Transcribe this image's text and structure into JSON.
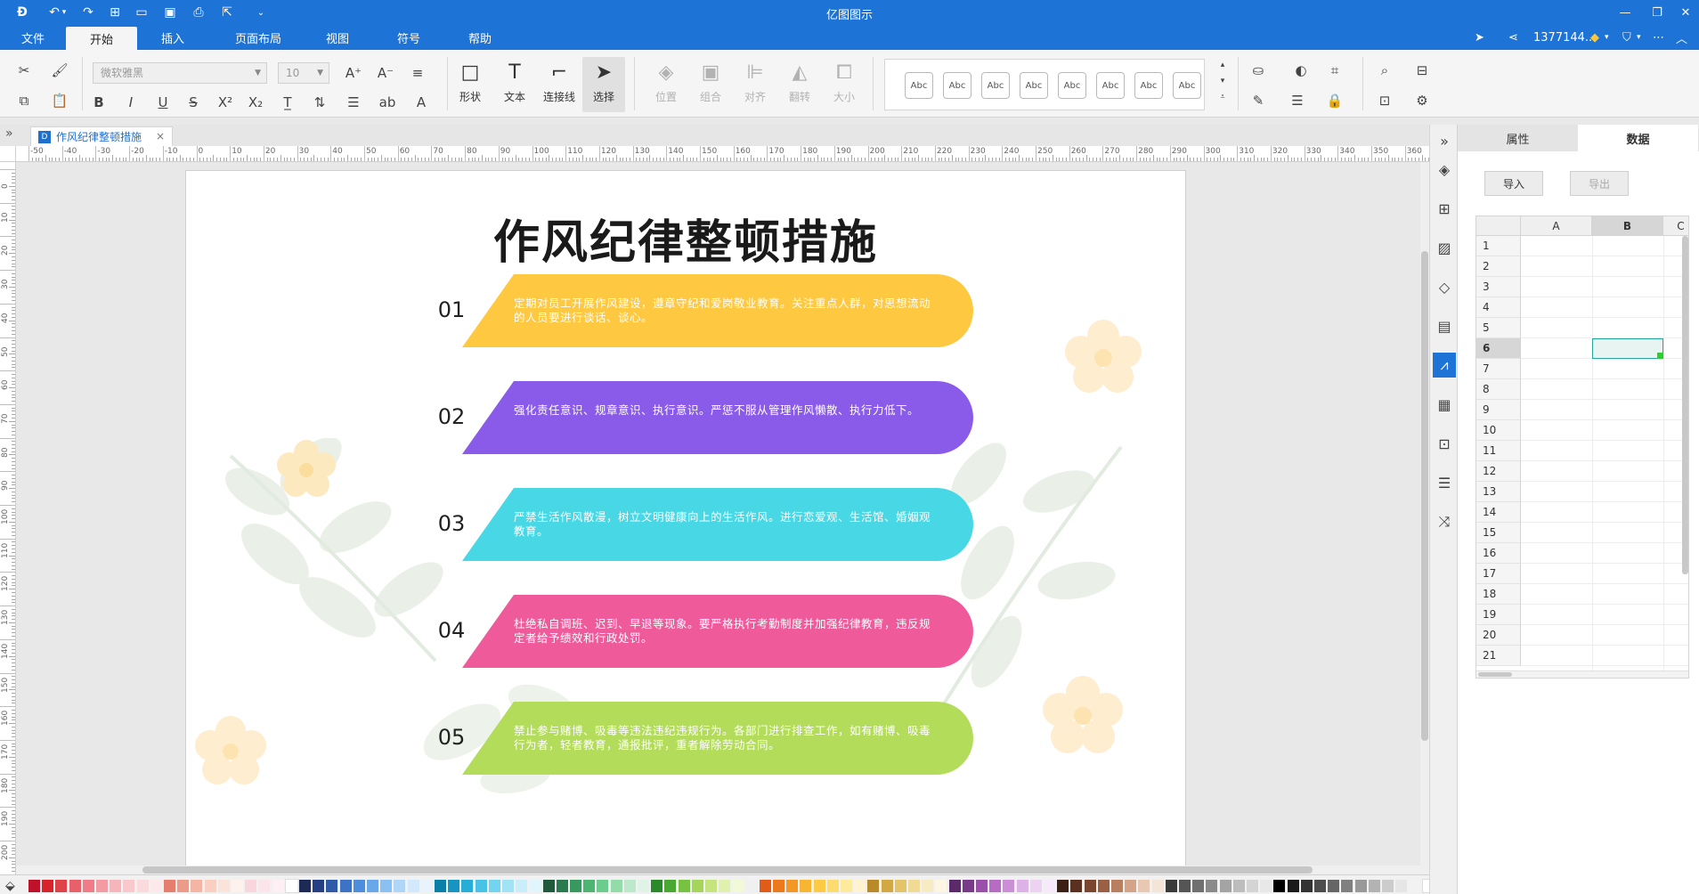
{
  "titlebar": {
    "title": "亿图图示",
    "quick_access": [
      "logo-icon",
      "undo-icon",
      "undo-dropdown-icon",
      "redo-icon",
      "new-icon",
      "open-icon",
      "save-icon",
      "print-icon",
      "export-icon",
      "customize-icon"
    ]
  },
  "menu": {
    "file": "文件",
    "tabs": [
      "开始",
      "插入",
      "页面布局",
      "视图",
      "符号",
      "帮助"
    ],
    "active_tab": "开始",
    "user": "1377144...",
    "accent": "#1d73d6"
  },
  "ribbon": {
    "font_name": "微软雅黑",
    "font_size": "10",
    "big_buttons": {
      "shape": "形状",
      "text": "文本",
      "connector": "连接线",
      "select": "选择",
      "position": "位置",
      "group": "组合",
      "align": "对齐",
      "flip": "翻转",
      "size": "大小"
    },
    "style_samples": [
      "Abc",
      "Abc",
      "Abc",
      "Abc",
      "Abc",
      "Abc",
      "Abc",
      "Abc"
    ]
  },
  "document": {
    "tab_name": "作风纪律整顿措施",
    "close": "×"
  },
  "ruler": {
    "h_labels": [
      "-50",
      "-40",
      "-30",
      "-20",
      "-10",
      "0",
      "10",
      "20",
      "30",
      "40",
      "50",
      "60",
      "70",
      "80",
      "90",
      "100",
      "110",
      "120",
      "130",
      "140",
      "150",
      "160",
      "170",
      "180",
      "190",
      "200",
      "210",
      "220",
      "230",
      "240",
      "250",
      "260",
      "270",
      "280",
      "290",
      "300",
      "310",
      "320",
      "330",
      "340",
      "350",
      "360"
    ],
    "v_labels": [
      "0",
      "10",
      "20",
      "30",
      "40",
      "50",
      "60",
      "70",
      "80",
      "90",
      "100",
      "110",
      "120",
      "130",
      "140",
      "150",
      "160",
      "170",
      "180",
      "190",
      "200"
    ]
  },
  "slide": {
    "title": "作风纪律整顿措施",
    "items": [
      {
        "num": "01",
        "text": "定期对员工开展作风建设，遵章守纪和爱岗敬业教育。关注重点人群，对思想流动的人员要进行谈话、谈心。",
        "color": "#fec840"
      },
      {
        "num": "02",
        "text": "强化责任意识、规章意识、执行意识。严惩不服从管理作风懒散、执行力低下。",
        "color": "#8a5ae8"
      },
      {
        "num": "03",
        "text": "严禁生活作风散漫，树立文明健康向上的生活作风。进行恋爱观、生活馆、婚姻观教育。",
        "color": "#48d7e4"
      },
      {
        "num": "04",
        "text": "杜绝私自调班、迟到、早退等现象。要严格执行考勤制度并加强纪律教育，违反规定者给予绩效和行政处罚。",
        "color": "#ef5a9a"
      },
      {
        "num": "05",
        "text": "禁止参与赌博、吸毒等违法违纪违规行为。各部门进行排查工作，如有赌博、吸毒行为者，轻者教育，通报批评，重者解除劳动合同。",
        "color": "#b3dc5a"
      }
    ]
  },
  "palette": {
    "colors": [
      "#c0112b",
      "#d9222a",
      "#e0424a",
      "#e8606a",
      "#ef7c86",
      "#f39aa2",
      "#f6b4bb",
      "#f8c8cc",
      "#fadadd",
      "#fde8ea",
      "#e67e6e",
      "#ee9a88",
      "#f4b5a4",
      "#f8cfc1",
      "#fbe3da",
      "#fff1ec",
      "#f9d5de",
      "#fbe4ea",
      "#fdeff3",
      "#ffffff",
      "#1c2a55",
      "#253f85",
      "#2e5aa8",
      "#3c73c4",
      "#4c8edc",
      "#67a7ea",
      "#8bc0f2",
      "#b0d6f7",
      "#d2e8fb",
      "#e8f3fd",
      "#0c7fa8",
      "#1596c2",
      "#27add6",
      "#48c3e6",
      "#73d4ef",
      "#9fe3f5",
      "#c8eefa",
      "#e1f6fc",
      "#1f5a3c",
      "#2a7a4f",
      "#38985f",
      "#4cb572",
      "#6ccc8b",
      "#93dcaa",
      "#bce9ca",
      "#dff4e6",
      "#2a8a2a",
      "#4aa832",
      "#78c242",
      "#a5d65a",
      "#c6e47e",
      "#e0f0ad",
      "#f2f9d8",
      "#f0f0f0",
      "#e05c18",
      "#ec7a1c",
      "#f39825",
      "#f8b531",
      "#fcca44",
      "#fddb6c",
      "#feea9c",
      "#fff4cf",
      "#b98a2a",
      "#d1a844",
      "#e3c468",
      "#f0db95",
      "#f8ebc2",
      "#fdf6e3",
      "#5a2a6a",
      "#7a3a8a",
      "#9a4fa8",
      "#b56cc2",
      "#cb8fd6",
      "#ddb2e6",
      "#ecd3f2",
      "#f6e9f9",
      "#3a1f14",
      "#5a3020",
      "#7a4630",
      "#9a6044",
      "#b88060",
      "#d4a488",
      "#e8c8b2",
      "#f5e4d8",
      "#3a3a3a",
      "#555555",
      "#707070",
      "#8a8a8a",
      "#a4a4a4",
      "#bdbdbd",
      "#d4d4d4",
      "#e8e8e8",
      "#000000",
      "#1a1a1a",
      "#333333",
      "#4d4d4d",
      "#666666",
      "#808080",
      "#999999",
      "#b3b3b3",
      "#cccccc",
      "#e6e6e6",
      "#f2f2f2",
      "#ffffff"
    ]
  },
  "right_strip": {
    "icons": [
      "expand-icon",
      "fill-icon",
      "shape-library-icon",
      "image-icon",
      "layers-icon",
      "page-icon",
      "chart-data-icon",
      "table-icon",
      "org-icon",
      "gantt-icon",
      "shuffle-icon"
    ],
    "active": "chart-data-icon"
  },
  "panel": {
    "tabs": [
      "属性",
      "数据"
    ],
    "active_tab": "数据",
    "import": "导入",
    "export": "导出",
    "columns": [
      "A",
      "B",
      "C"
    ],
    "selected_column": "B",
    "rows": [
      "1",
      "2",
      "3",
      "4",
      "5",
      "6",
      "7",
      "8",
      "9",
      "10",
      "11",
      "12",
      "13",
      "14",
      "15",
      "16",
      "17",
      "18",
      "19",
      "20",
      "21"
    ],
    "selected_row": "6"
  }
}
